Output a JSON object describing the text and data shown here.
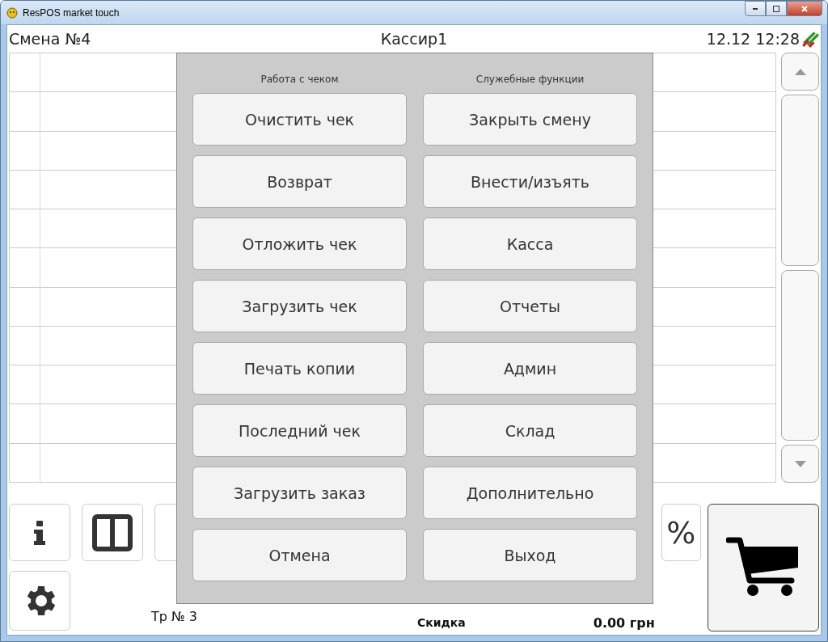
{
  "window": {
    "title": "ResPOS market touch"
  },
  "header": {
    "shift": "Смена №4",
    "cashier": "Кассир1",
    "datetime": "12.12 12:28"
  },
  "bottom": {
    "percent_button": "%",
    "terminal": "Тр № 3",
    "discount_label": "Скидка",
    "discount_amount": "0.00 грн"
  },
  "menu": {
    "columns": [
      {
        "heading": "Работа с чеком",
        "items": [
          "Очистить чек",
          "Возврат",
          "Отложить чек",
          "Загрузить чек",
          "Печать копии",
          "Последний чек",
          "Загрузить заказ",
          "Отмена"
        ]
      },
      {
        "heading": "Служебные функции",
        "items": [
          "Закрыть смену",
          "Внести/изъять",
          "Касса",
          "Отчеты",
          "Админ",
          "Склад",
          "Дополнительно",
          "Выход"
        ]
      }
    ]
  }
}
